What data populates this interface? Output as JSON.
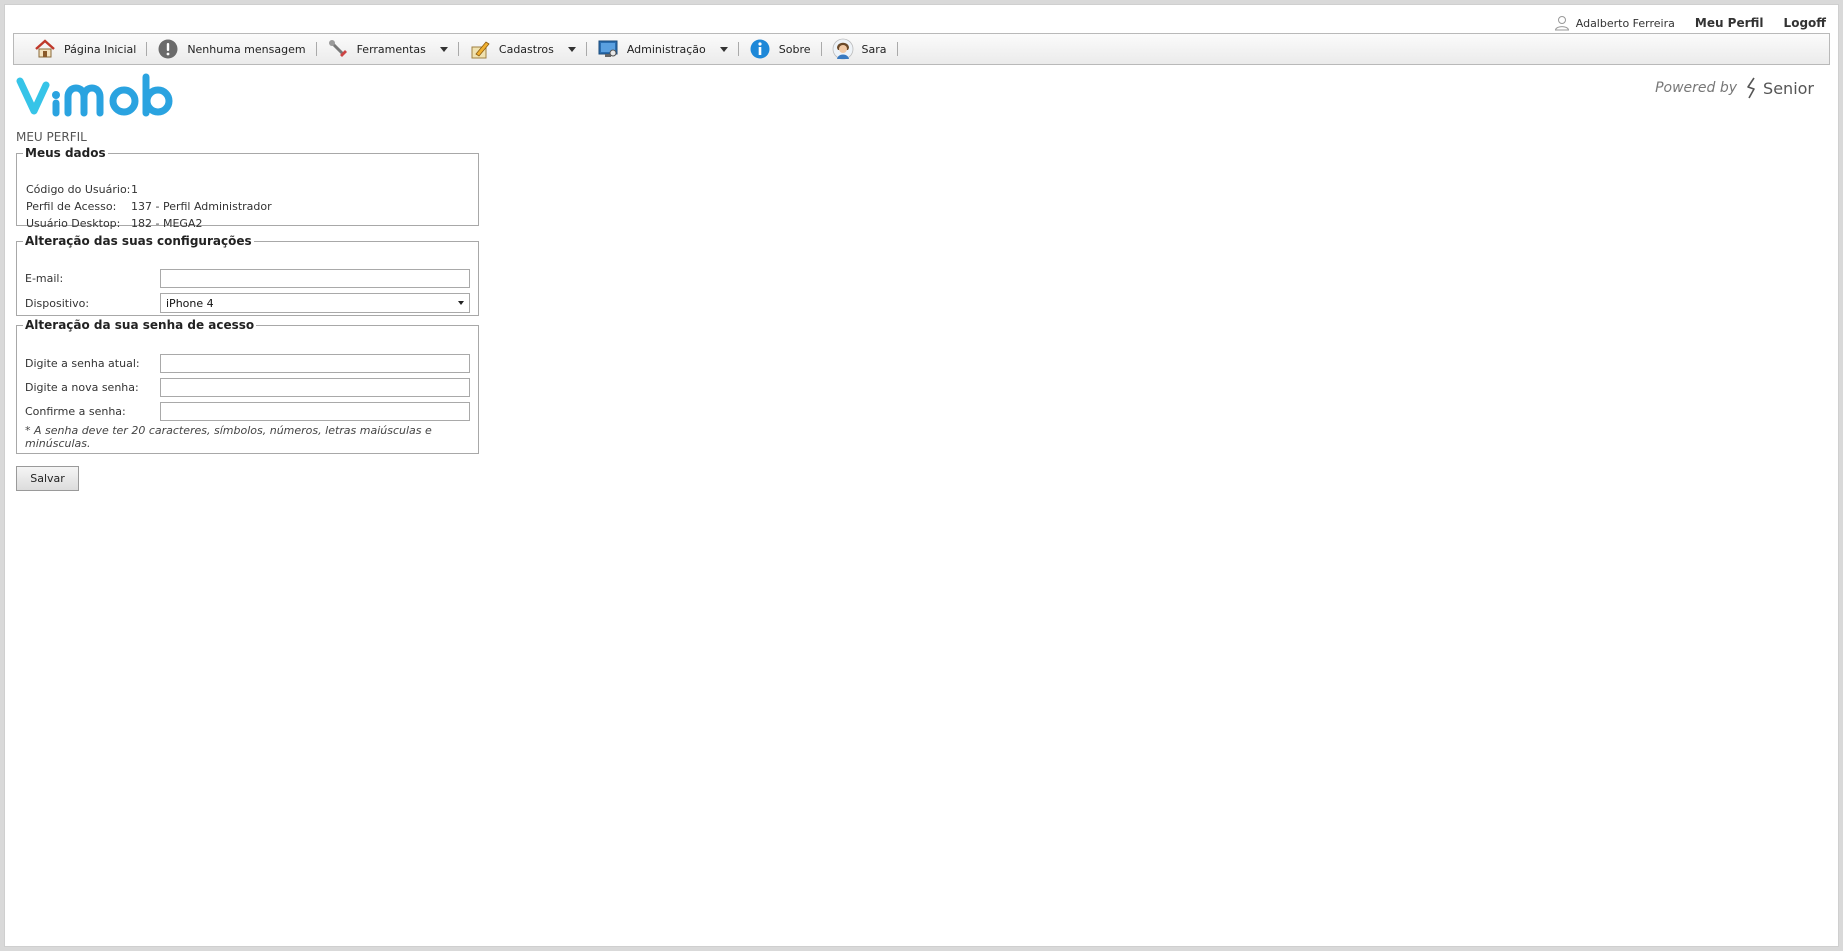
{
  "userbar": {
    "user_name": "Adalberto Ferreira",
    "profile_link": "Meu Perfil",
    "logoff_link": "Logoff"
  },
  "menu": {
    "home": "Página Inicial",
    "messages": "Nenhuma mensagem",
    "tools": "Ferramentas",
    "registers": "Cadastros",
    "admin": "Administração",
    "about": "Sobre",
    "sara": "Sara"
  },
  "brand": {
    "logo_text": "vimob",
    "powered_by": "Powered by",
    "vendor": "Senior",
    "accent": "#2aa3e0"
  },
  "page": {
    "title": "MEU PERFIL"
  },
  "meus_dados": {
    "legend": "Meus dados",
    "rows": [
      {
        "label": "Código do Usuário:",
        "value": "1"
      },
      {
        "label": "Perfil de Acesso:",
        "value": "137 - Perfil Administrador"
      },
      {
        "label": "Usuário Desktop:",
        "value": "182 - MEGA2"
      }
    ]
  },
  "config": {
    "legend": "Alteração das suas configurações",
    "email_label": "E-mail:",
    "email_value": "",
    "device_label": "Dispositivo:",
    "device_value": "iPhone 4"
  },
  "password": {
    "legend": "Alteração da sua senha de acesso",
    "current_label": "Digite a senha atual:",
    "new_label": "Digite a nova senha:",
    "confirm_label": "Confirme a senha:",
    "note": "* A senha deve ter 20 caracteres, símbolos, números, letras maiúsculas e minúsculas."
  },
  "actions": {
    "save": "Salvar"
  }
}
